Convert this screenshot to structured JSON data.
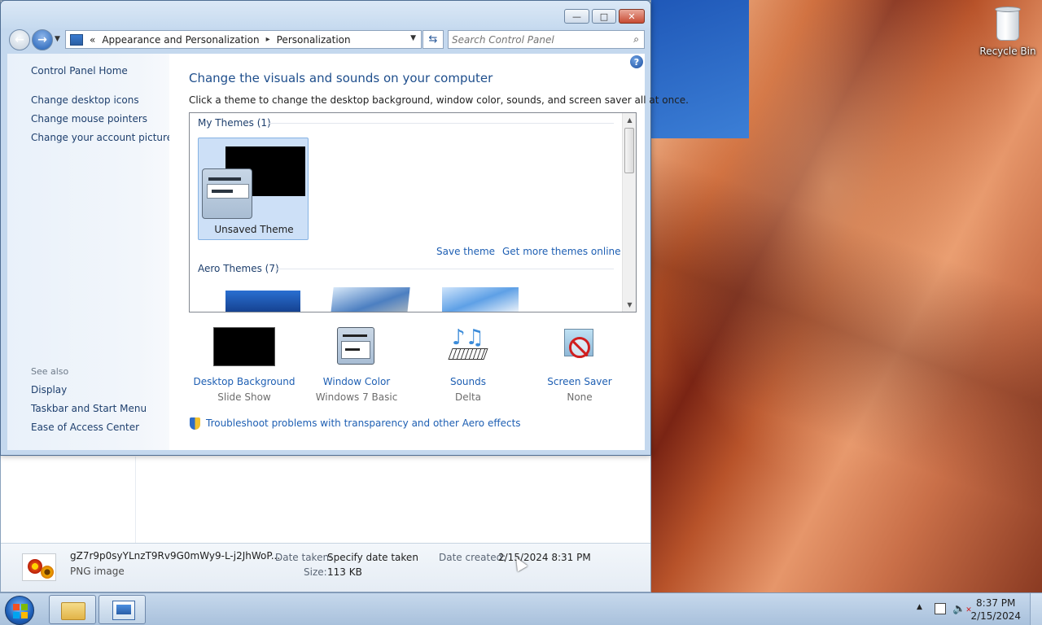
{
  "desktop": {
    "recycle_bin_label": "Recycle Bin"
  },
  "control_panel": {
    "window_buttons": {
      "minimize": "—",
      "maximize": "□",
      "close": "✕"
    },
    "address": {
      "overflow": "«",
      "crumbs": [
        "Appearance and Personalization",
        "Personalization"
      ],
      "separator": "▸"
    },
    "search": {
      "placeholder": "Search Control Panel"
    },
    "left_nav": {
      "home": "Control Panel Home",
      "links": [
        "Change desktop icons",
        "Change mouse pointers",
        "Change your account picture"
      ],
      "see_also_label": "See also",
      "see_also": [
        "Display",
        "Taskbar and Start Menu",
        "Ease of Access Center"
      ]
    },
    "main": {
      "heading": "Change the visuals and sounds on your computer",
      "subheading": "Click a theme to change the desktop background, window color, sounds, and screen saver all at once.",
      "my_themes_label": "My Themes (1)",
      "unsaved_theme": "Unsaved Theme",
      "save_theme": "Save theme",
      "get_more_themes": "Get more themes online",
      "aero_themes_label": "Aero Themes (7)",
      "options": [
        {
          "title": "Desktop Background",
          "value": "Slide Show",
          "icon": "desktop-background-icon"
        },
        {
          "title": "Window Color",
          "value": "Windows 7 Basic",
          "icon": "window-color-icon"
        },
        {
          "title": "Sounds",
          "value": "Delta",
          "icon": "sounds-icon"
        },
        {
          "title": "Screen Saver",
          "value": "None",
          "icon": "screen-saver-icon"
        }
      ],
      "troubleshoot": "Troubleshoot problems with transparency and other Aero effects",
      "help": "?"
    }
  },
  "explorer_details": {
    "file_name": "gZ7r9p0syYLnzT9Rv9G0mWy9-L-j2JhWoP...",
    "file_type": "PNG image",
    "date_taken_label": "Date taken:",
    "date_taken_value": "Specify date taken",
    "size_label": "Size:",
    "size_value": "113 KB",
    "date_created_label": "Date created:",
    "date_created_value": "2/15/2024 8:31 PM"
  },
  "taskbar": {
    "time": "8:37 PM",
    "date": "2/15/2024",
    "tray_arrow": "▲"
  }
}
